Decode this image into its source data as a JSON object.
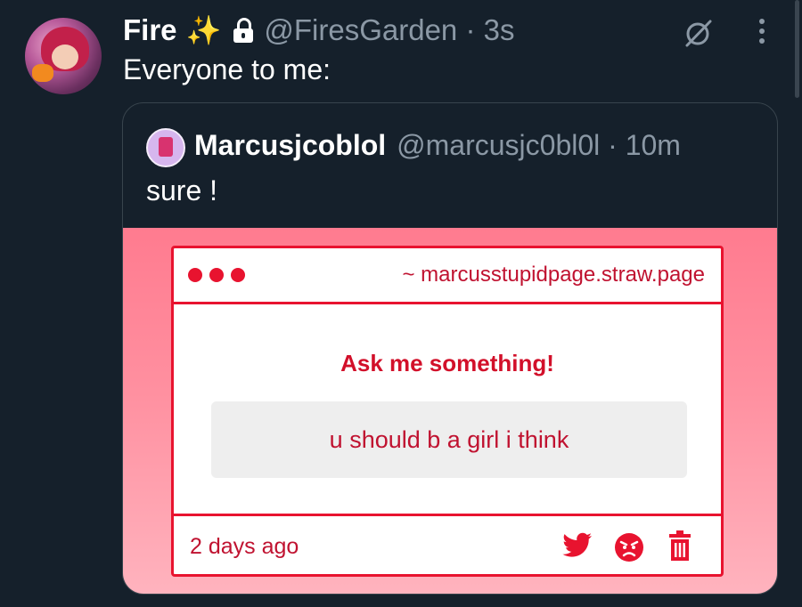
{
  "tweet": {
    "display_name": "Fire",
    "sparkle_emoji": "✨",
    "handle_time": "@FiresGarden · 3s",
    "text": "Everyone to me:"
  },
  "quote": {
    "display_name": "Marcusjcoblol",
    "handle_time": "@marcusjc0bl0l · 10m",
    "text": "sure !"
  },
  "media_card": {
    "url": "~ marcusstupidpage.straw.page",
    "title": "Ask me something!",
    "question": "u should b a girl i think",
    "timestamp": "2 days ago"
  },
  "colors": {
    "background": "#15202b",
    "accent_red": "#e8132f",
    "muted_text": "#8b98a5"
  },
  "icons": [
    "lock-icon",
    "grok-icon",
    "more-icon",
    "twitter-bird-icon",
    "angry-face-icon",
    "trash-icon"
  ]
}
